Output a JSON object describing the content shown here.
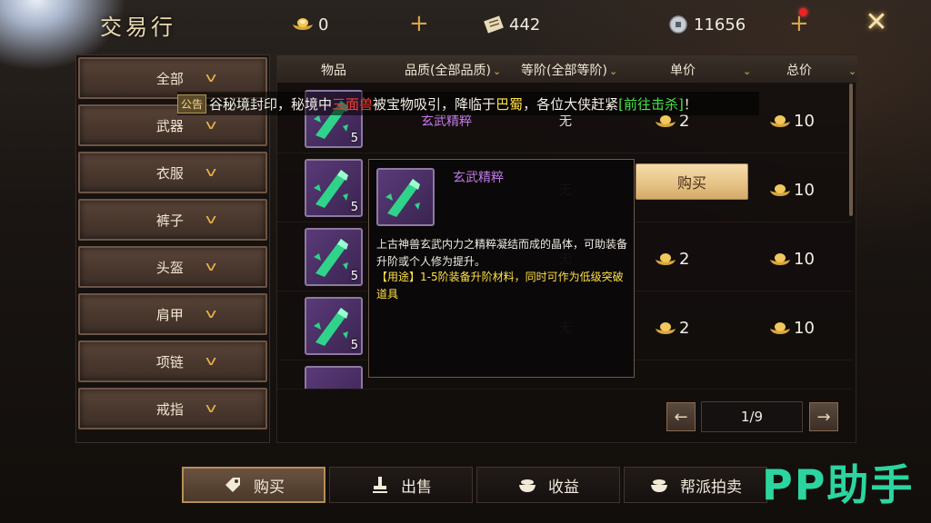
{
  "header": {
    "title": "交易行"
  },
  "currencies": {
    "ingot": {
      "value": "0",
      "icon": "gold-ingot-icon"
    },
    "scroll": {
      "value": "442",
      "icon": "scroll-icon"
    },
    "coin": {
      "value": "11656",
      "icon": "coin-icon"
    }
  },
  "sidebar": {
    "items": [
      {
        "label": "全部"
      },
      {
        "label": "武器"
      },
      {
        "label": "衣服"
      },
      {
        "label": "裤子"
      },
      {
        "label": "头盔"
      },
      {
        "label": "肩甲"
      },
      {
        "label": "项链"
      },
      {
        "label": "戒指"
      }
    ]
  },
  "table": {
    "columns": {
      "item": "物品",
      "quality": "品质(全部品质)",
      "grade": "等阶(全部等阶)",
      "unit_price": "单价",
      "total_price": "总价"
    },
    "rows": [
      {
        "name": "玄武精粹",
        "grade": "无",
        "qty": "5",
        "unit_price": "2",
        "total_price": "10"
      },
      {
        "name": "",
        "grade": "无",
        "qty": "5",
        "unit_price": "",
        "total_price": "10"
      },
      {
        "name": "",
        "grade": "无",
        "qty": "5",
        "unit_price": "2",
        "total_price": "10"
      },
      {
        "name": "",
        "grade": "无",
        "qty": "5",
        "unit_price": "2",
        "total_price": "10"
      }
    ],
    "buy_label": "购买"
  },
  "notice": {
    "tag": "公告",
    "part1": "谷秘境封印，秘境中",
    "monster": "三面兽",
    "part2": "被宝物吸引，降临于",
    "place": "巴蜀",
    "part3": "，各位大侠赶紧",
    "link": "[前往击杀]",
    "part4": "！"
  },
  "tooltip": {
    "name": "玄武精粹",
    "description": "上古神兽玄武内力之精粹凝结而成的晶体，可助装备升阶或个人修为提升。",
    "usage": "【用途】1-5阶装备升阶材料，同时可作为低级突破道具"
  },
  "pager": {
    "text": "1/9"
  },
  "tabs": [
    {
      "label": "购买",
      "icon": "buy-tag-icon"
    },
    {
      "label": "出售",
      "icon": "sell-stamp-icon"
    },
    {
      "label": "收益",
      "icon": "treasure-bowl-icon"
    },
    {
      "label": "帮派拍卖",
      "icon": "treasure-bowl-icon"
    }
  ],
  "watermark": "PP助手",
  "colors": {
    "accent": "#e8b24a",
    "item_purple": "#c27ae8",
    "notice_red": "#ff3b30",
    "notice_green": "#45e34a",
    "notice_yellow": "#ffe14a"
  }
}
